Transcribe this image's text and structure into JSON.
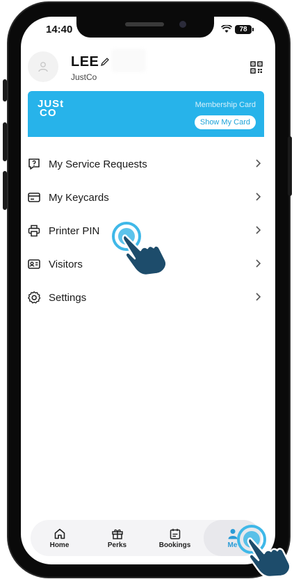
{
  "status_bar": {
    "time": "14:40",
    "battery": "78"
  },
  "profile": {
    "name": "LEE",
    "company": "JustCo"
  },
  "membership_card": {
    "logo_line1": "JUSt",
    "logo_line2": "CO",
    "label": "Membership Card",
    "button_label": "Show My Card"
  },
  "menu": {
    "items": [
      {
        "label": "My Service Requests",
        "icon": "help-bubble-icon"
      },
      {
        "label": "My Keycards",
        "icon": "keycard-icon"
      },
      {
        "label": "Printer PIN",
        "icon": "printer-icon"
      },
      {
        "label": "Visitors",
        "icon": "visitor-id-icon"
      },
      {
        "label": "Settings",
        "icon": "gear-icon"
      }
    ]
  },
  "tabbar": {
    "tabs": [
      {
        "label": "Home",
        "icon": "home-icon"
      },
      {
        "label": "Perks",
        "icon": "gift-icon"
      },
      {
        "label": "Bookings",
        "icon": "calendar-icon"
      },
      {
        "label": "Me",
        "icon": "person-icon"
      }
    ],
    "active": "Me"
  },
  "colors": {
    "brand_blue": "#27b3ea",
    "active_tab": "#2a9bd6"
  }
}
